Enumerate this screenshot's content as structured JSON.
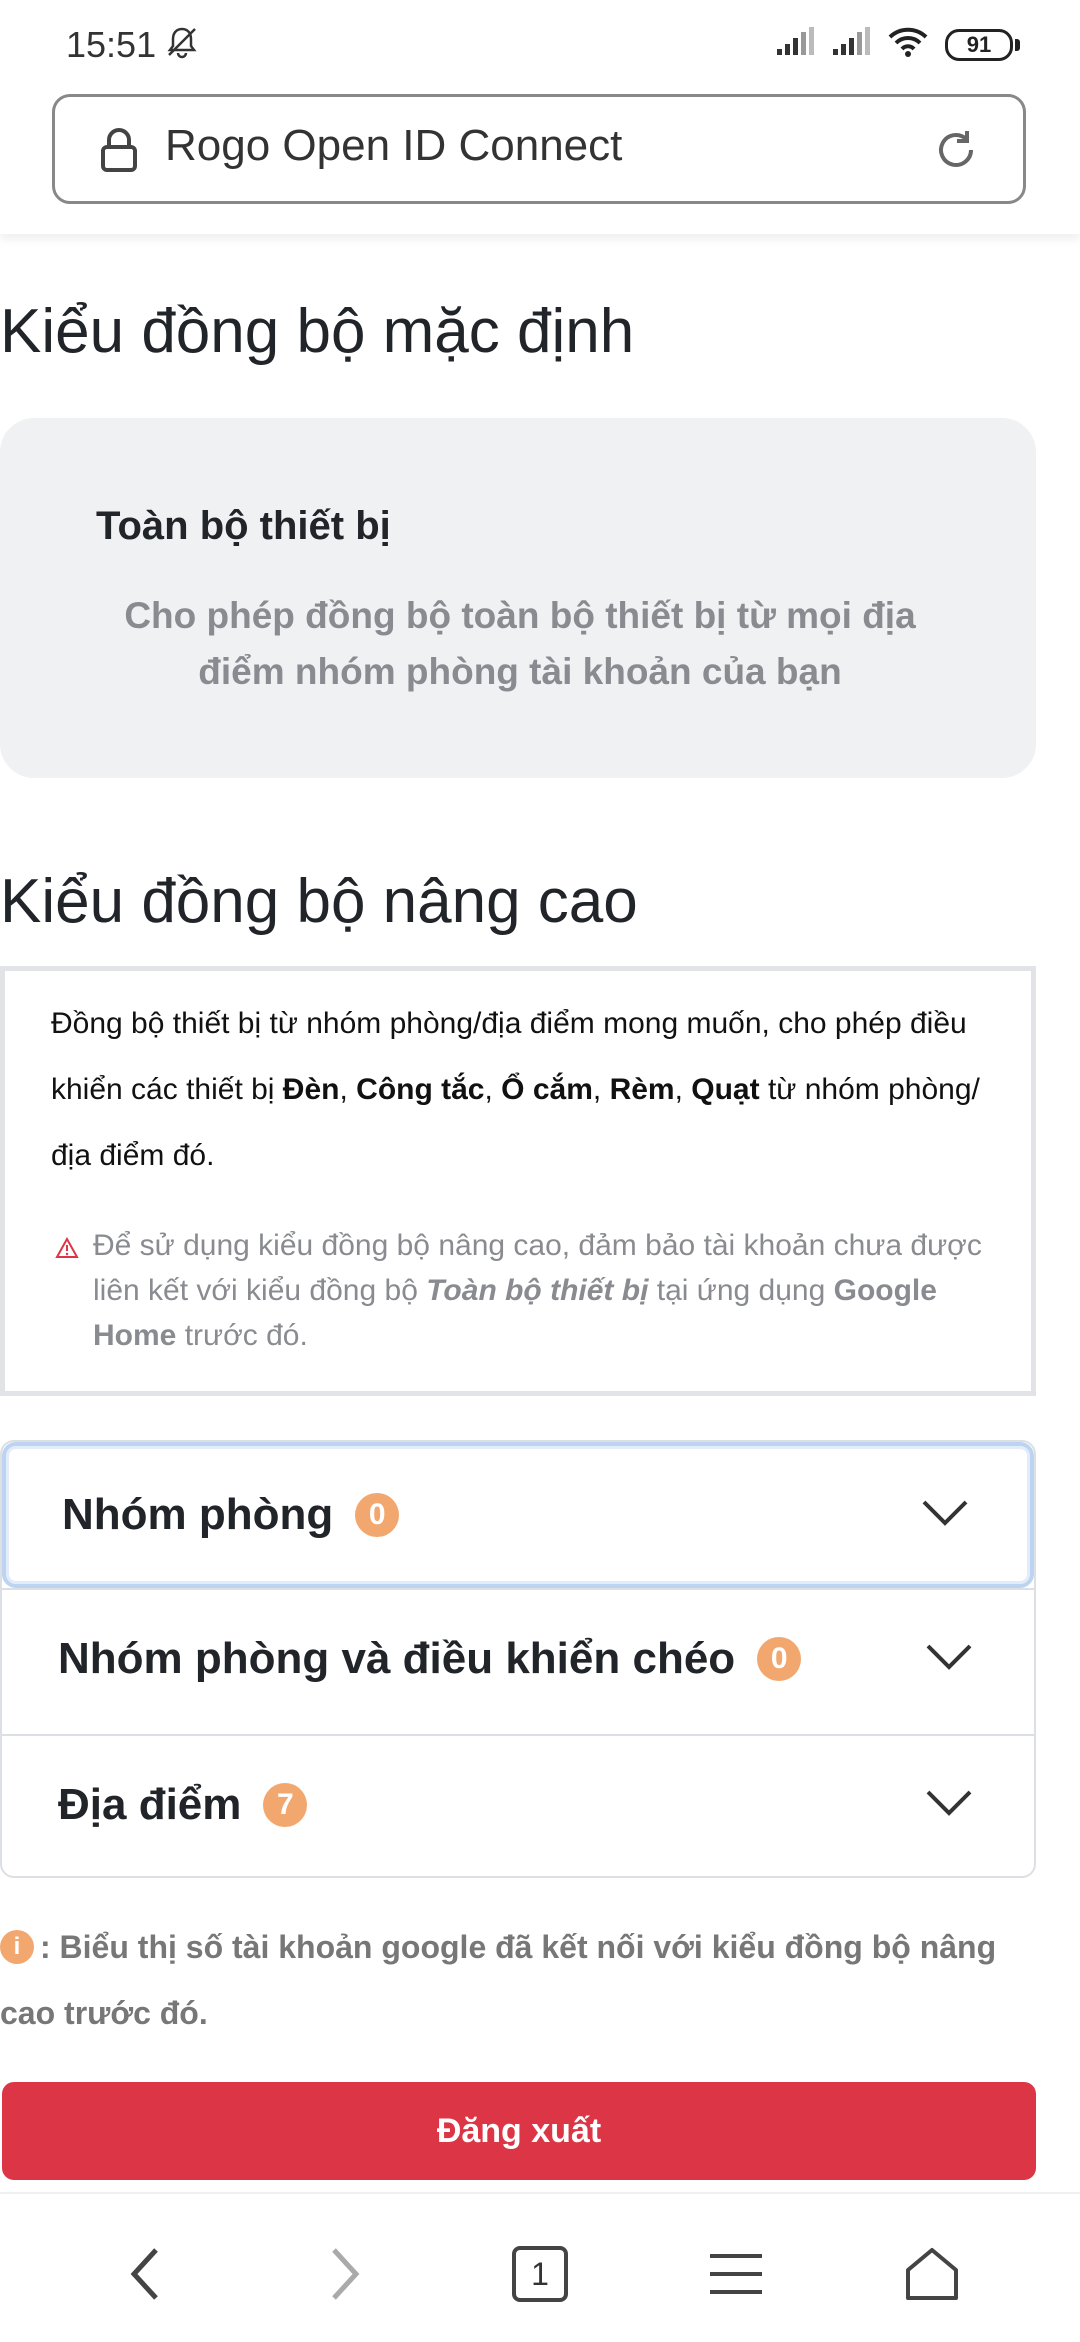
{
  "status_bar": {
    "time": "15:51",
    "battery": "91",
    "icons": [
      "bell-off-icon",
      "signal-icon",
      "signal-icon",
      "wifi-icon",
      "battery-icon"
    ]
  },
  "browser": {
    "url_title": "Rogo Open ID Connect",
    "tab_count": "1"
  },
  "default_sync": {
    "heading": "Kiểu đồng bộ mặc định",
    "card_title": "Toàn bộ thiết bị",
    "card_desc": "Cho phép đồng bộ toàn bộ thiết bị từ mọi địa điểm nhóm phòng tài khoản của bạn"
  },
  "advanced_sync": {
    "heading": "Kiểu đồng bộ nâng cao",
    "desc_prefix": "Đồng bộ thiết bị từ nhóm phòng/địa điểm mong muốn, cho phép điều khiển các thiết bị ",
    "device_den": "Đèn",
    "device_congtac": "Công tắc",
    "device_ocam": "Ổ cắm",
    "device_rem": "Rèm",
    "device_quat": "Quạt",
    "sep_comma": ", ",
    "desc_suffix": " từ nhóm phòng/ địa điểm đó.",
    "warn_prefix": "Để sử dụng kiểu đồng bộ nâng cao, đảm bảo tài khoản chưa được liên kết với kiểu đồng bộ ",
    "warn_italic": "Toàn bộ thiết bị",
    "warn_middle": " tại ứng dụng ",
    "warn_bold": "Google Home",
    "warn_suffix": " trước đó."
  },
  "accordion": [
    {
      "label": "Nhóm phòng",
      "count": "0"
    },
    {
      "label": "Nhóm phòng và điều khiển chéo",
      "count": "0"
    },
    {
      "label": "Địa điểm",
      "count": "7"
    }
  ],
  "note": {
    "icon_glyph": "i",
    "text": ": Biểu thị số tài khoản google đã kết nối với kiểu đồng bộ nâng cao trước đó."
  },
  "logout_label": "Đăng xuất",
  "colors": {
    "logout": "#dc3545",
    "badge": "#f2a76f",
    "card_bg": "#f0f1f3",
    "muted_text": "#898b90"
  }
}
